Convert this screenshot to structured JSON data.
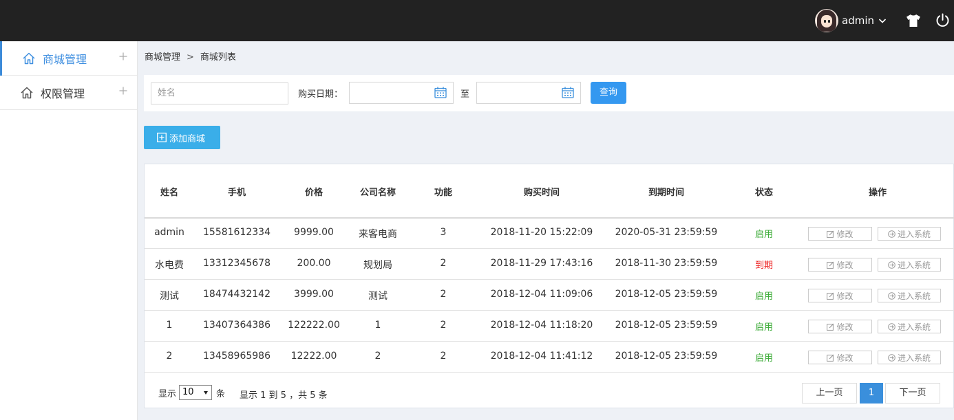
{
  "header": {
    "username": "admin",
    "icons": [
      "avatar",
      "chevron-down-icon",
      "tshirt-icon",
      "power-icon"
    ]
  },
  "sidebar": {
    "items": [
      {
        "label": "商城管理",
        "icon": "home-icon",
        "active": true
      },
      {
        "label": "权限管理",
        "icon": "home-icon",
        "active": false
      }
    ]
  },
  "breadcrumb": {
    "root": "商城管理",
    "separator": ">",
    "current": "商城列表"
  },
  "filter": {
    "name_placeholder": "姓名",
    "date_label": "购买日期：",
    "to_label": "至",
    "start_date": "",
    "end_date": "",
    "query_label": "查询"
  },
  "add_button_label": "添加商城",
  "table": {
    "columns": [
      "姓名",
      "手机",
      "价格",
      "公司名称",
      "功能",
      "购买时间",
      "到期时间",
      "状态",
      "操作"
    ],
    "edit_label": "修改",
    "enter_label": "进入系统",
    "rows": [
      {
        "name": "admin",
        "phone": "15581612334",
        "price": "9999.00",
        "company": "来客电商",
        "func": "3",
        "buy": "2018-11-20 15:22:09",
        "expire": "2020-05-31 23:59:59",
        "status": "启用",
        "status_type": "on"
      },
      {
        "name": "水电费",
        "phone": "13312345678",
        "price": "200.00",
        "company": "规划局",
        "func": "2",
        "buy": "2018-11-29 17:43:16",
        "expire": "2018-11-30 23:59:59",
        "status": "到期",
        "status_type": "off"
      },
      {
        "name": "测试",
        "phone": "18474432142",
        "price": "3999.00",
        "company": "测试",
        "func": "2",
        "buy": "2018-12-04 11:09:06",
        "expire": "2018-12-05 23:59:59",
        "status": "启用",
        "status_type": "on"
      },
      {
        "name": "1",
        "phone": "13407364386",
        "price": "122222.00",
        "company": "1",
        "func": "2",
        "buy": "2018-12-04 11:18:20",
        "expire": "2018-12-05 23:59:59",
        "status": "启用",
        "status_type": "on"
      },
      {
        "name": "2",
        "phone": "13458965986",
        "price": "12222.00",
        "company": "2",
        "func": "2",
        "buy": "2018-12-04 11:41:12",
        "expire": "2018-12-05 23:59:59",
        "status": "启用",
        "status_type": "on"
      }
    ]
  },
  "footer": {
    "show_label": "显示",
    "page_size": "10",
    "unit_label": "条",
    "info": "显示 1 到 5 ，共 5 条",
    "prev_label": "上一页",
    "current_page": "1",
    "next_label": "下一页"
  },
  "colors": {
    "accent": "#3498f0",
    "topbar": "#222222",
    "enabled": "#3aaa35",
    "expired": "#ee2222"
  }
}
